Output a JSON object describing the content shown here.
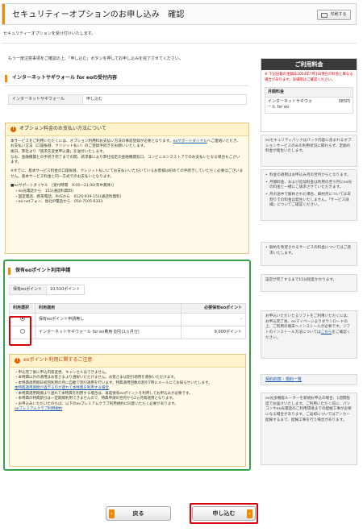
{
  "header": {
    "title": "セキュリティーオプションのお申し込み　確認",
    "print": "印刷する"
  },
  "intro": [
    "セキュリティーオプションを受け付けいたします。",
    "もう一度注意事項をご確認の上、「申し込む」ボタンを押してお申し込みを完了させてください。"
  ],
  "firewall": {
    "title": "インターネットサギウォール for eoの受付内容",
    "label": "インターネットサギウォール",
    "value": "申し込む"
  },
  "payment": {
    "title": "オプション料金のお支払い方法について",
    "p1": "本サービスをご利用いただくには、オプション利用料お支払い方法の事前登録が必要となります。",
    "p1_link": "eoサポートダイヤル",
    "p1b": "へご連絡いただき、お支払い方法（口座振替、クリジット払い）のご登録手続きをお願いいたします。",
    "p2": "後日、弊社より「請求先変更申込書」を送付いたします。",
    "p3": "なお、金融機関との手続き完了までの間、請求書により弊社指定の金融機関窓口、コンビニエンスストアでのお支払いとなる場合もございます。",
    "p4": "※すでに、基本サービス料金の口座振替、クレジット払いにてお支払いいただいているお客様は初めての手続きしていただく必要はございません。基本サービス料金と同一方式でのお支払いとなります。",
    "contact_head": "■eoサポートダイヤル　[受付時間　9:00〜21:00(年中無休)]",
    "contacts": [
      "・eo光電話から　151(通話料無料)",
      "・固定電話、携帯電話、PHSから　0120-919-151(通話料無料)",
      "・eo-netフォン、他社IP電話から　050-7105-6333"
    ]
  },
  "points": {
    "title": "保有eoポイント利用申請",
    "holding_label": "保有eoポイント",
    "holding_value": "10,510ポイント",
    "col_select": "利用選択",
    "col_desc": "利用適用",
    "col_required": "必要保有eoポイント",
    "options": [
      {
        "label": "保有eoポイント申請無し",
        "required": "-"
      },
      {
        "label": "インターネットサギウォール for eo費用 割引(1ヵ月分)",
        "required": "9,000ポイント"
      }
    ],
    "notice_title": "eoポイント利用に関するご注意",
    "notices": [
      "・申込完了後に申込内容変更、キャンセルはできません。",
      "・本特典以外の適用はお客さまより選択いただけません。お客さまは割引適用を選択いただけます。",
      "・本特典適用期日初回利用の月に自動で割引適用を行います。特典適用回数の割引7時にメールにてお知らせいたします。",
      "・本特典適用期間より遅れて本特典を利用する場合は、再度保有eoポイントを利用してお申込みが必要です。",
      "・本特典の特典割引は一定期間利用できませんので、特典申請の翌月から2ヵ月間適用となります。",
      "・お申込みいただいたのちは、以下のeoプレミアムクラブ利用規約に同意いただく必要があります。"
    ],
    "link1": "本特典適用期間が過ぎるのが遅れて本特典を利用する場合",
    "link2": "eoプレミアムクラブ利用規約"
  },
  "fee": {
    "title": "ご利用料金",
    "warning": "※ 下記記載の金額は2024年7月1日現在の料金と異なる場合があります。詳細等はご確認ください。",
    "monthly": "月額料金",
    "service": "インターネットサギウォール for eo",
    "price": "385円"
  },
  "side_notes": {
    "n1": "eoセキュリティパックはパック内容に含まれるオプションサービスのみの利用状況に関わらず、定額の料金が発生いたします。",
    "n2": [
      "料金の適用はお申込み月の翌月からとなります。",
      "月額料金、および追加料金は利用の翌々月にeo光の料金と一緒にご請求させていただきます。",
      "月の途中で解約された場合、解約月については日割りでの料金は発生いたしません。「サービス詳細」についてご確認ください。"
    ],
    "n3": [
      "解約を希望されるサービスの料金についてはご請求いたします。"
    ],
    "n4": "設定が完了するまで15分程度かかります。",
    "n5": "お申込いただいたるソフトをご利用いただくには、お申込完了後、eoマイページよりダウンロードの上、ご利用の端末へインストールが必要です。ソフトのインストール方法については",
    "n5_link": "こちら",
    "n5b": "をご確認ください。",
    "terms": "契約約款・規約一覧",
    "n6": "eo光多機能ルーターを新規お申込の場合、1週間程度でお届けいたします。ご利用いただく前に、パソコンやeo光電話のご利用環境までの配線工事が必要になる場合があります。ご返却についてはアンカー配線するまで、配線工事を行う場合があります。"
  },
  "buttons": {
    "back": "戻る",
    "submit": "申し込む"
  }
}
